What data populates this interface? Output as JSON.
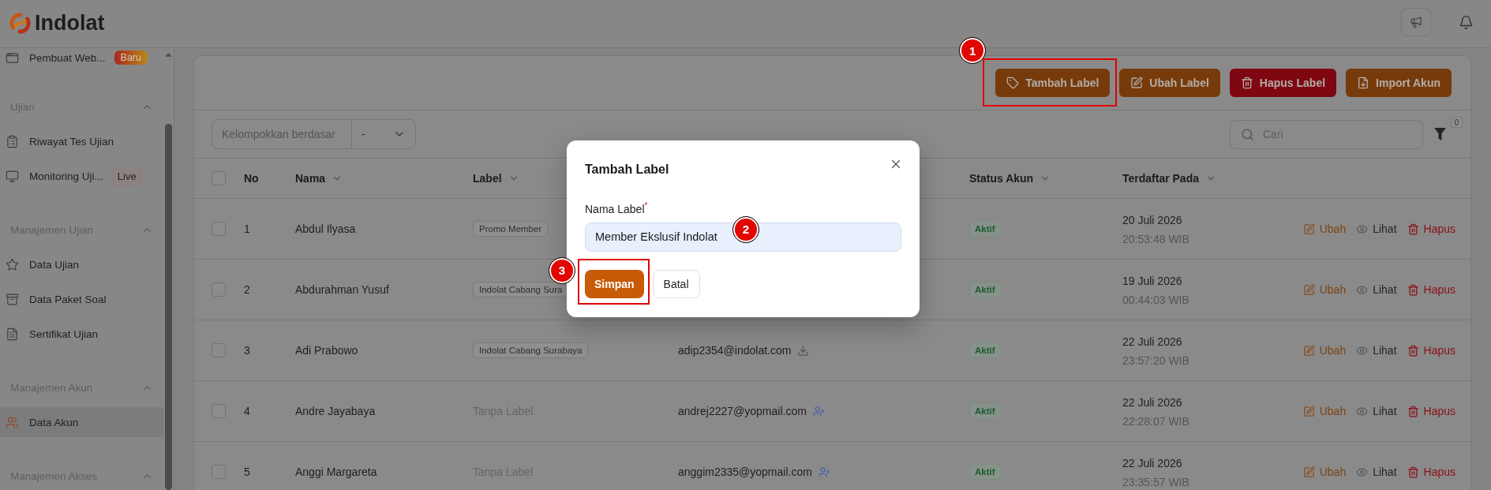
{
  "header": {
    "brand": "Indolat"
  },
  "sidebar": {
    "items": [
      {
        "label": "Pembuat Web...",
        "selected": false,
        "badge": {
          "text": "Baru",
          "kind": "new"
        }
      }
    ],
    "sections": [
      {
        "title": "Ujian",
        "expanded": true,
        "items": [
          {
            "label": "Riwayat Tes Ujian",
            "selected": false
          },
          {
            "label": "Monitoring Uji...",
            "selected": false,
            "badge": {
              "text": "Live",
              "kind": "live"
            }
          }
        ]
      },
      {
        "title": "Manajemen Ujian",
        "expanded": true,
        "items": [
          {
            "label": "Data Ujian",
            "selected": false
          },
          {
            "label": "Data Paket Soal",
            "selected": false
          },
          {
            "label": "Sertifikat Ujian",
            "selected": false
          }
        ]
      },
      {
        "title": "Manajemen Akun",
        "expanded": true,
        "items": [
          {
            "label": "Data Akun",
            "selected": true
          }
        ]
      },
      {
        "title": "Manajemen Akses",
        "expanded": true
      }
    ]
  },
  "actions": [
    {
      "label": "Tambah Label",
      "kind": "primary",
      "highlighted": true,
      "step": "1"
    },
    {
      "label": "Ubah Label",
      "kind": "primary",
      "highlighted": false
    },
    {
      "label": "Hapus Label",
      "kind": "danger",
      "highlighted": false
    },
    {
      "label": "Import Akun",
      "kind": "primary",
      "highlighted": false
    }
  ],
  "filters": {
    "group_by": {
      "label": "Kelompokkan berdasar",
      "value": "-"
    },
    "search": {
      "placeholder": "Cari"
    },
    "filter_count": "0"
  },
  "table": {
    "all_checked": false,
    "columns": [
      {
        "label": "No",
        "sortable": false
      },
      {
        "label": "Nama",
        "sortable": true
      },
      {
        "label": "Label",
        "sortable": true
      },
      {
        "label": "Status Akun",
        "sortable": true
      },
      {
        "label": "Terdaftar Pada",
        "sortable": true
      }
    ],
    "rows": [
      {
        "checked": false,
        "no": "1",
        "name": "Abdul Ilyasa",
        "label": {
          "text": "Promo Member",
          "kind": "tag"
        },
        "status": "Aktif",
        "date": "20 Juli 2026",
        "time": "20:53:48 WIB",
        "actions": [
          {
            "label": "Ubah",
            "kind": "edit"
          },
          {
            "label": "Lihat",
            "kind": "view"
          },
          {
            "label": "Hapus",
            "kind": "delete"
          }
        ]
      },
      {
        "checked": false,
        "no": "2",
        "name": "Abdurahman Yusuf",
        "label": {
          "text": "Indolat Cabang Sura",
          "kind": "tag"
        },
        "status": "Aktif",
        "date": "19 Juli 2026",
        "time": "00:44:03 WIB",
        "actions": [
          {
            "label": "Ubah",
            "kind": "edit"
          },
          {
            "label": "Lihat",
            "kind": "view"
          },
          {
            "label": "Hapus",
            "kind": "delete"
          }
        ]
      },
      {
        "checked": false,
        "no": "3",
        "name": "Adi Prabowo",
        "label": {
          "text": "Indolat Cabang Surabaya",
          "kind": "tag"
        },
        "email": "adip2354@indolat.com",
        "status": "Aktif",
        "date": "22 Juli 2026",
        "time": "23:57:20 WIB",
        "actions": [
          {
            "label": "Ubah",
            "kind": "edit"
          },
          {
            "label": "Lihat",
            "kind": "view"
          },
          {
            "label": "Hapus",
            "kind": "delete"
          }
        ]
      },
      {
        "checked": false,
        "no": "4",
        "name": "Andre Jayabaya",
        "label": {
          "text": "Tanpa Label",
          "kind": "empty"
        },
        "email": "andrej2227@yopmail.com",
        "status": "Aktif",
        "date": "22 Juli 2026",
        "time": "22:28:07 WIB",
        "actions": [
          {
            "label": "Ubah",
            "kind": "edit"
          },
          {
            "label": "Lihat",
            "kind": "view"
          },
          {
            "label": "Hapus",
            "kind": "delete"
          }
        ]
      },
      {
        "checked": false,
        "no": "5",
        "name": "Anggi Margareta",
        "label": {
          "text": "Tanpa Label",
          "kind": "empty"
        },
        "email": "anggim2335@yopmail.com",
        "status": "Aktif",
        "date": "22 Juli 2026",
        "time": "23:35:57 WIB",
        "actions": [
          {
            "label": "Ubah",
            "kind": "edit"
          },
          {
            "label": "Lihat",
            "kind": "view"
          },
          {
            "label": "Hapus",
            "kind": "delete"
          }
        ]
      }
    ]
  },
  "modal": {
    "title": "Tambah Label",
    "field": {
      "label": "Nama Label$^{*}$",
      "value": "Member Ekslusif Indolat",
      "step": "2"
    },
    "buttons": [
      {
        "label": "Simpan",
        "kind": "primary",
        "highlighted": true,
        "step": "3"
      },
      {
        "label": "Batal",
        "kind": "secondary",
        "highlighted": false
      }
    ]
  }
}
